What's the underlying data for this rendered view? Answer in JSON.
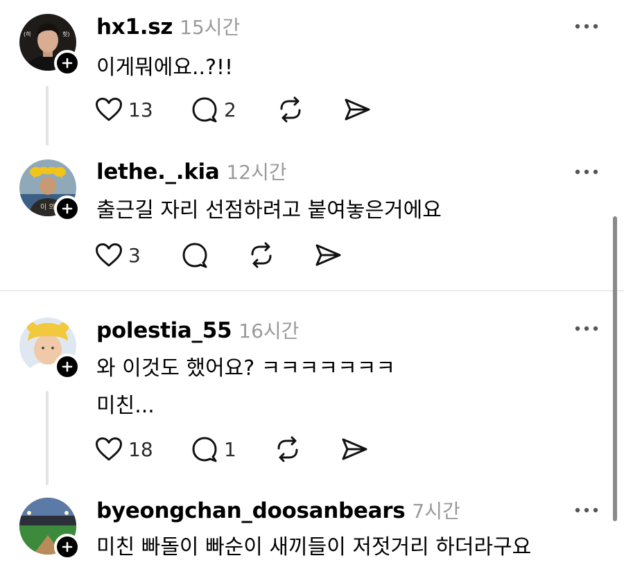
{
  "posts": [
    {
      "username": "hx1.sz",
      "time": "15시간",
      "lines": [
        "이게뭐에요..?!!"
      ],
      "likes": "13",
      "replies": "2",
      "avatar_text_left": "(히",
      "avatar_text_right": "힛)"
    },
    {
      "username": "lethe._.kia",
      "time": "12시간",
      "lines": [
        "출근길 자리 선점하려고 붙여놓은거에요"
      ],
      "likes": "3",
      "replies": "",
      "avatar_text": "이 의"
    },
    {
      "username": "polestia_55",
      "time": "16시간",
      "lines": [
        "와 이것도 했어요? ㅋㅋㅋㅋㅋㅋㅋ",
        "미친..."
      ],
      "likes": "18",
      "replies": "1"
    },
    {
      "username": "byeongchan_doosanbears",
      "time": "7시간",
      "lines": [
        "미친 빠돌이 빠순이 새끼들이 저젓거리 하더라구요"
      ],
      "likes": "",
      "replies": ""
    }
  ],
  "icons": {
    "like": "heart-icon",
    "reply": "comment-icon",
    "repost": "repost-icon",
    "share": "send-icon",
    "more": "more-icon",
    "follow": "plus-icon"
  },
  "colors": {
    "text": "#000000",
    "muted": "#9a9a9a",
    "thread_line": "#e3e3e3",
    "separator": "#dcdcdc"
  }
}
